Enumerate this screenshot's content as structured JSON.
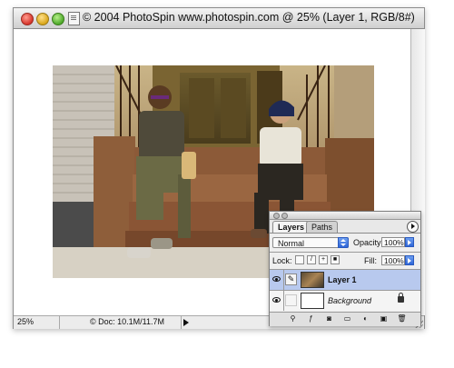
{
  "window": {
    "title": "© 2004 PhotoSpin www.photospin.com @ 25% (Layer 1, RGB/8#)"
  },
  "statusbar": {
    "zoom": "25%",
    "doc_info": "© Doc: 10.1M/11.7M"
  },
  "layers_palette": {
    "tabs": [
      {
        "label": "Layers",
        "active": true
      },
      {
        "label": "Paths",
        "active": false
      }
    ],
    "blend_mode": "Normal",
    "opacity_label": "Opacity:",
    "opacity_value": "100%",
    "lock_label": "Lock:",
    "fill_label": "Fill:",
    "fill_value": "100%",
    "layers": [
      {
        "name": "Layer 1",
        "selected": true,
        "visible": true
      },
      {
        "name": "Background",
        "selected": false,
        "visible": true,
        "locked": true
      }
    ]
  },
  "colors": {
    "selection": "#b8c9ee",
    "accent": "#2f66d8"
  }
}
